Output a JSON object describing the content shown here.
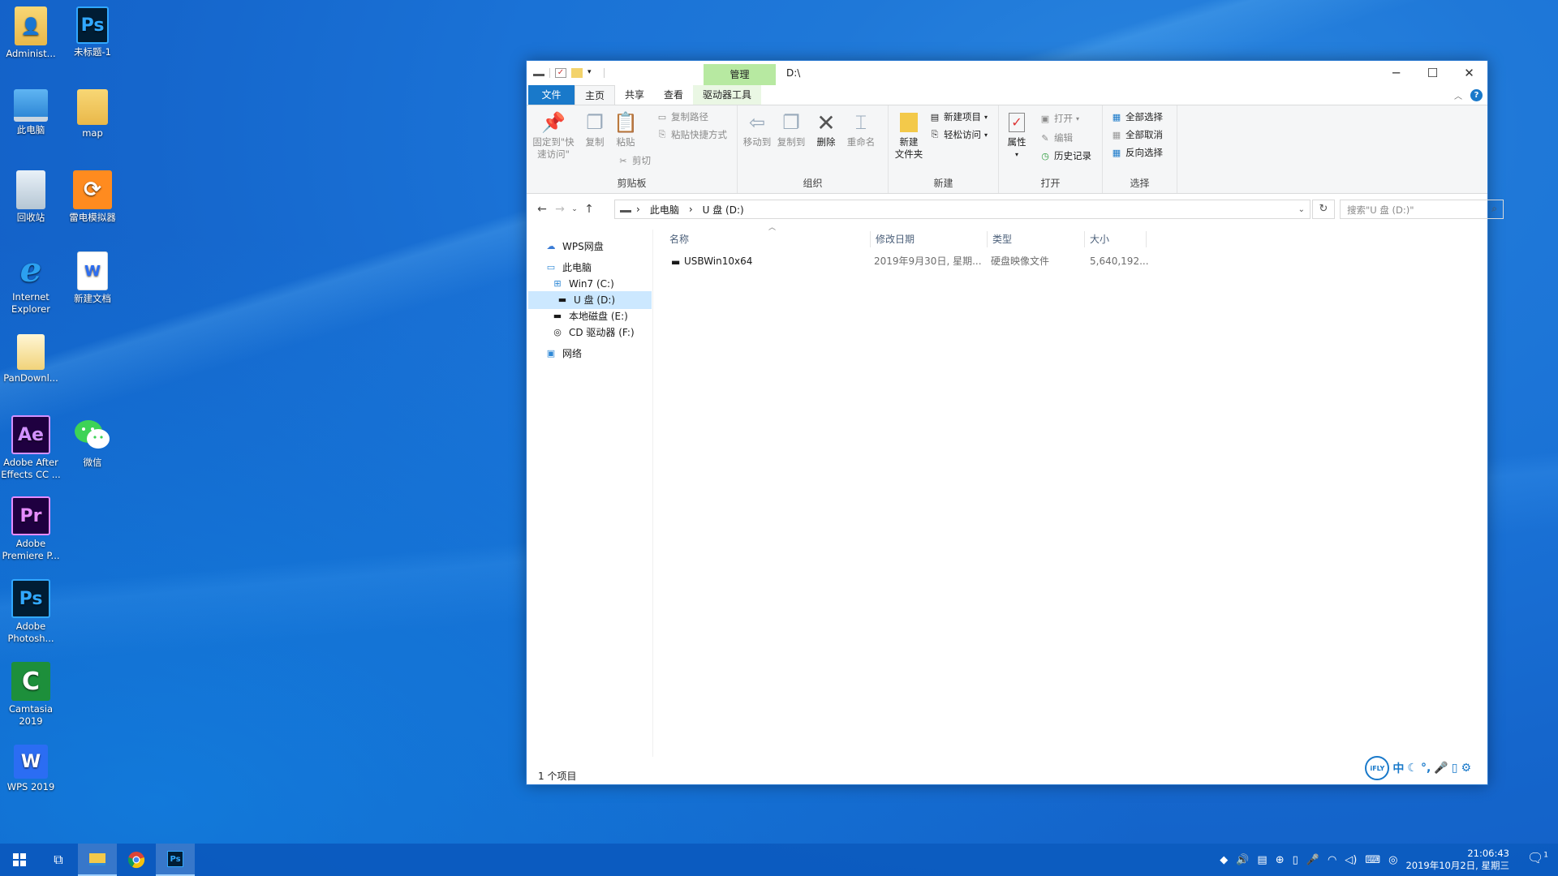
{
  "desktop": {
    "icons": [
      {
        "label": "Administ...",
        "icon": "user-folder-icon"
      },
      {
        "label": "未标题-1",
        "icon": "psd-file-icon",
        "glyph": "Ps"
      },
      {
        "label": "此电脑",
        "icon": "this-pc-icon"
      },
      {
        "label": "map",
        "icon": "folder-icon"
      },
      {
        "label": "回收站",
        "icon": "recycle-bin-icon"
      },
      {
        "label": "雷电模拟器",
        "icon": "ldplayer-icon"
      },
      {
        "label": "Internet Explorer",
        "icon": "internet-explorer-icon",
        "glyph": "e"
      },
      {
        "label": "新建文档",
        "icon": "wps-doc-icon",
        "glyph": "W"
      },
      {
        "label": "PanDownl...",
        "icon": "pandownload-folder-icon"
      },
      {
        "label": "Adobe After Effects CC ...",
        "icon": "after-effects-icon",
        "glyph": "Ae"
      },
      {
        "label": "微信",
        "icon": "wechat-icon"
      },
      {
        "label": "Adobe Premiere P...",
        "icon": "premiere-icon",
        "glyph": "Pr"
      },
      {
        "label": "Adobe Photosh...",
        "icon": "photoshop-icon",
        "glyph": "Ps"
      },
      {
        "label": "Camtasia 2019",
        "icon": "camtasia-icon",
        "glyph": "C"
      },
      {
        "label": "WPS 2019",
        "icon": "wps-office-icon",
        "glyph": "W"
      }
    ]
  },
  "explorer": {
    "context_tab": "管理",
    "title": "D:\\",
    "tabs": {
      "file": "文件",
      "home": "主页",
      "share": "共享",
      "view": "查看",
      "drive_tools": "驱动器工具"
    },
    "ribbon": {
      "clipboard": {
        "label": "剪贴板",
        "pin": "固定到\"快速访问\"",
        "copy": "复制",
        "paste": "粘贴",
        "copy_path": "复制路径",
        "paste_shortcut": "粘贴快捷方式",
        "cut": "剪切"
      },
      "organize": {
        "label": "组织",
        "move_to": "移动到",
        "copy_to": "复制到",
        "delete": "删除",
        "rename": "重命名"
      },
      "new": {
        "label": "新建",
        "new_folder": "新建\n文件夹",
        "new_item": "新建项目",
        "easy_access": "轻松访问"
      },
      "open": {
        "label": "打开",
        "properties": "属性",
        "open": "打开",
        "edit": "编辑",
        "history": "历史记录"
      },
      "select": {
        "label": "选择",
        "select_all": "全部选择",
        "select_none": "全部取消",
        "invert": "反向选择"
      }
    },
    "address": {
      "crumbs": [
        "此电脑",
        "U 盘 (D:)"
      ],
      "search_placeholder": "搜索\"U 盘 (D:)\""
    },
    "nav": {
      "wps": "WPS网盘",
      "this_pc": "此电脑",
      "drives": [
        "Win7 (C:)",
        "U 盘 (D:)",
        "本地磁盘 (E:)",
        "CD 驱动器 (F:)"
      ],
      "network": "网络"
    },
    "columns": {
      "name": "名称",
      "modified": "修改日期",
      "type": "类型",
      "size": "大小"
    },
    "files": [
      {
        "name": "USBWin10x64",
        "modified": "2019年9月30日, 星期...",
        "type": "硬盘映像文件",
        "size": "5,640,192..."
      }
    ],
    "status": "1 个项目",
    "ime": {
      "logo": "iFLY",
      "lang": "中"
    }
  },
  "taskbar": {
    "time": "21:06:43",
    "date": "2019年10月2日, 星期三",
    "notifications": "1"
  }
}
